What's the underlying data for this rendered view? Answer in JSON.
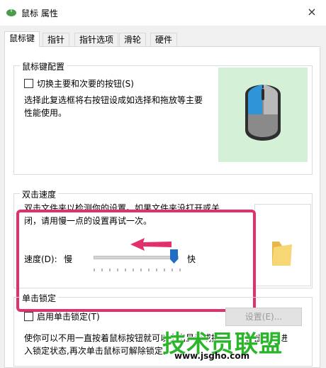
{
  "window": {
    "title": "鼠标 属性",
    "close_icon": "×"
  },
  "tabs": [
    {
      "label": "鼠标键",
      "active": true
    },
    {
      "label": "指针"
    },
    {
      "label": "指针选项"
    },
    {
      "label": "滑轮"
    },
    {
      "label": "硬件"
    }
  ],
  "button_config": {
    "group_title": "鼠标键配置",
    "checkbox_label": "切换主要和次要的按钮(S)",
    "checked": false,
    "description_line1": "选择此复选框将右按钮设成如选择和拖放等主要",
    "description_line2": "性能使用。"
  },
  "double_click": {
    "group_title": "双击速度",
    "description_line1": "双击文件夹以检测你的设置。如果文件夹没打开或关",
    "description_line2": "闭，请用慢一点的设置再试一次。",
    "speed_label": "速度(D):",
    "slow_label": "慢",
    "fast_label": "快",
    "speed_value_fraction": 1.0
  },
  "click_lock": {
    "group_title": "单击锁定",
    "checkbox_label": "启用单击锁定(T)",
    "checked": false,
    "settings_button": "设置(E)...",
    "description_line1": "使你可以不用一直按着鼠标按钮就可以突出显示或拖拽。单击鼠标以进",
    "description_line2": "入锁定状态,再次单击鼠标可解除锁定。"
  },
  "colors": {
    "highlight": "#e1306c",
    "arrow": "#e1306c",
    "mouse_pane_bg": "#d4f1d7",
    "watermark_green": "#2bb52b"
  },
  "watermark": {
    "brand": "技术员联盟",
    "url": "www.jsgho.com"
  },
  "icons": {
    "title_icon": "mouse-icon",
    "mouse_picture": "mouse-icon",
    "folder_picture": "folder-icon",
    "annotation_arrow": "arrow-left-icon"
  }
}
